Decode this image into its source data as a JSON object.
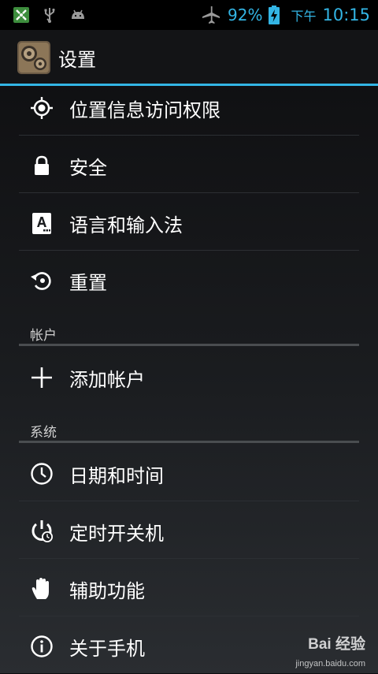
{
  "status_bar": {
    "icons": [
      "app-notification-icon",
      "usb-icon",
      "android-debug-icon",
      "airplane-mode-icon",
      "battery-charging-icon"
    ],
    "battery_percent": "92%",
    "ampm": "下午",
    "time": "10:15"
  },
  "header": {
    "icon": "settings-gears-icon",
    "title": "设置"
  },
  "items": {
    "location": {
      "label": "位置信息访问权限",
      "icon": "location-target-icon"
    },
    "security": {
      "label": "安全",
      "icon": "lock-icon"
    },
    "language": {
      "label": "语言和输入法",
      "icon": "keyboard-language-icon"
    },
    "reset": {
      "label": "重置",
      "icon": "reset-icon"
    },
    "add_account": {
      "label": "添加帐户",
      "icon": "plus-icon"
    },
    "date_time": {
      "label": "日期和时间",
      "icon": "clock-icon"
    },
    "scheduled_power": {
      "label": "定时开关机",
      "icon": "power-timer-icon"
    },
    "accessibility": {
      "label": "辅助功能",
      "icon": "hand-icon"
    },
    "about_phone": {
      "label": "关于手机",
      "icon": "info-icon"
    }
  },
  "sections": {
    "accounts": "帐户",
    "system": "系统"
  },
  "watermark": {
    "logo": "Bai  经验",
    "url": "jingyan.baidu.com"
  },
  "colors": {
    "accent": "#33b5e5",
    "background": "#1a1c1f",
    "text": "#ffffff"
  }
}
